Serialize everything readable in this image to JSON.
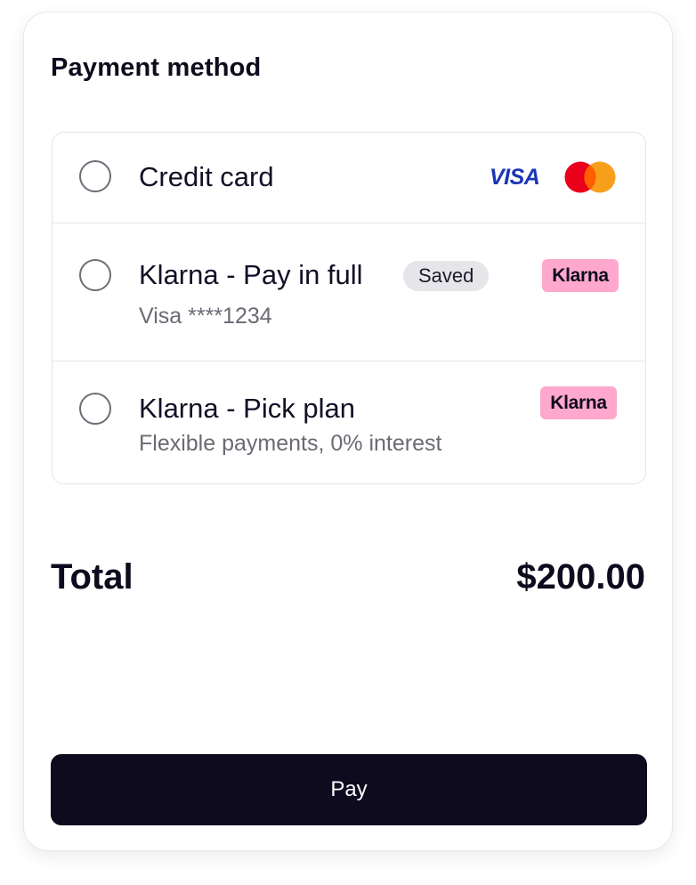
{
  "payment": {
    "title": "Payment method",
    "options": [
      {
        "label": "Credit card",
        "logos": [
          "VISA",
          "mastercard-logo"
        ]
      },
      {
        "label": "Klarna - Pay in full",
        "badge": "Saved",
        "subtitle": "Visa ****1234",
        "logo": "Klarna"
      },
      {
        "label": "Klarna - Pick plan",
        "subtitle": "Flexible payments, 0% interest",
        "logo": "Klarna"
      }
    ]
  },
  "summary": {
    "total_label": "Total",
    "total_amount": "$200.00"
  },
  "actions": {
    "pay_label": "Pay"
  },
  "colors": {
    "primary": "#0e0b1e",
    "klarna_pink": "#ffa8cd",
    "visa_blue": "#1a36b6",
    "mastercard_red": "#eb001b",
    "mastercard_orange": "#f79e1b"
  }
}
